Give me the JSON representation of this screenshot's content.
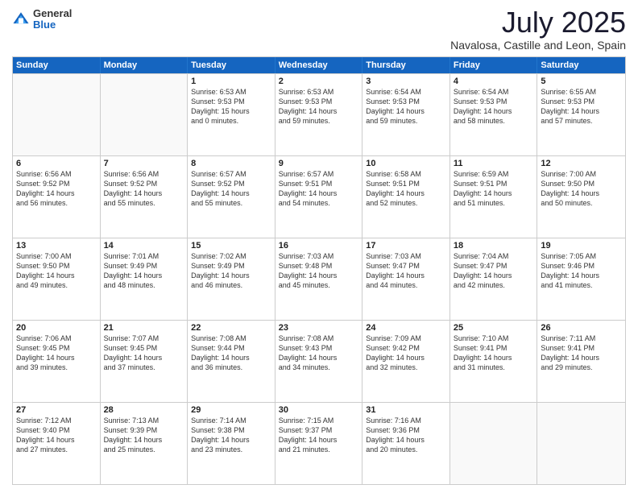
{
  "header": {
    "logo": {
      "general": "General",
      "blue": "Blue"
    },
    "title": "July 2025",
    "location": "Navalosa, Castille and Leon, Spain"
  },
  "calendar": {
    "days": [
      "Sunday",
      "Monday",
      "Tuesday",
      "Wednesday",
      "Thursday",
      "Friday",
      "Saturday"
    ],
    "rows": [
      [
        {
          "day": "",
          "lines": []
        },
        {
          "day": "",
          "lines": []
        },
        {
          "day": "1",
          "lines": [
            "Sunrise: 6:53 AM",
            "Sunset: 9:53 PM",
            "Daylight: 15 hours",
            "and 0 minutes."
          ]
        },
        {
          "day": "2",
          "lines": [
            "Sunrise: 6:53 AM",
            "Sunset: 9:53 PM",
            "Daylight: 14 hours",
            "and 59 minutes."
          ]
        },
        {
          "day": "3",
          "lines": [
            "Sunrise: 6:54 AM",
            "Sunset: 9:53 PM",
            "Daylight: 14 hours",
            "and 59 minutes."
          ]
        },
        {
          "day": "4",
          "lines": [
            "Sunrise: 6:54 AM",
            "Sunset: 9:53 PM",
            "Daylight: 14 hours",
            "and 58 minutes."
          ]
        },
        {
          "day": "5",
          "lines": [
            "Sunrise: 6:55 AM",
            "Sunset: 9:53 PM",
            "Daylight: 14 hours",
            "and 57 minutes."
          ]
        }
      ],
      [
        {
          "day": "6",
          "lines": [
            "Sunrise: 6:56 AM",
            "Sunset: 9:52 PM",
            "Daylight: 14 hours",
            "and 56 minutes."
          ]
        },
        {
          "day": "7",
          "lines": [
            "Sunrise: 6:56 AM",
            "Sunset: 9:52 PM",
            "Daylight: 14 hours",
            "and 55 minutes."
          ]
        },
        {
          "day": "8",
          "lines": [
            "Sunrise: 6:57 AM",
            "Sunset: 9:52 PM",
            "Daylight: 14 hours",
            "and 55 minutes."
          ]
        },
        {
          "day": "9",
          "lines": [
            "Sunrise: 6:57 AM",
            "Sunset: 9:51 PM",
            "Daylight: 14 hours",
            "and 54 minutes."
          ]
        },
        {
          "day": "10",
          "lines": [
            "Sunrise: 6:58 AM",
            "Sunset: 9:51 PM",
            "Daylight: 14 hours",
            "and 52 minutes."
          ]
        },
        {
          "day": "11",
          "lines": [
            "Sunrise: 6:59 AM",
            "Sunset: 9:51 PM",
            "Daylight: 14 hours",
            "and 51 minutes."
          ]
        },
        {
          "day": "12",
          "lines": [
            "Sunrise: 7:00 AM",
            "Sunset: 9:50 PM",
            "Daylight: 14 hours",
            "and 50 minutes."
          ]
        }
      ],
      [
        {
          "day": "13",
          "lines": [
            "Sunrise: 7:00 AM",
            "Sunset: 9:50 PM",
            "Daylight: 14 hours",
            "and 49 minutes."
          ]
        },
        {
          "day": "14",
          "lines": [
            "Sunrise: 7:01 AM",
            "Sunset: 9:49 PM",
            "Daylight: 14 hours",
            "and 48 minutes."
          ]
        },
        {
          "day": "15",
          "lines": [
            "Sunrise: 7:02 AM",
            "Sunset: 9:49 PM",
            "Daylight: 14 hours",
            "and 46 minutes."
          ]
        },
        {
          "day": "16",
          "lines": [
            "Sunrise: 7:03 AM",
            "Sunset: 9:48 PM",
            "Daylight: 14 hours",
            "and 45 minutes."
          ]
        },
        {
          "day": "17",
          "lines": [
            "Sunrise: 7:03 AM",
            "Sunset: 9:47 PM",
            "Daylight: 14 hours",
            "and 44 minutes."
          ]
        },
        {
          "day": "18",
          "lines": [
            "Sunrise: 7:04 AM",
            "Sunset: 9:47 PM",
            "Daylight: 14 hours",
            "and 42 minutes."
          ]
        },
        {
          "day": "19",
          "lines": [
            "Sunrise: 7:05 AM",
            "Sunset: 9:46 PM",
            "Daylight: 14 hours",
            "and 41 minutes."
          ]
        }
      ],
      [
        {
          "day": "20",
          "lines": [
            "Sunrise: 7:06 AM",
            "Sunset: 9:45 PM",
            "Daylight: 14 hours",
            "and 39 minutes."
          ]
        },
        {
          "day": "21",
          "lines": [
            "Sunrise: 7:07 AM",
            "Sunset: 9:45 PM",
            "Daylight: 14 hours",
            "and 37 minutes."
          ]
        },
        {
          "day": "22",
          "lines": [
            "Sunrise: 7:08 AM",
            "Sunset: 9:44 PM",
            "Daylight: 14 hours",
            "and 36 minutes."
          ]
        },
        {
          "day": "23",
          "lines": [
            "Sunrise: 7:08 AM",
            "Sunset: 9:43 PM",
            "Daylight: 14 hours",
            "and 34 minutes."
          ]
        },
        {
          "day": "24",
          "lines": [
            "Sunrise: 7:09 AM",
            "Sunset: 9:42 PM",
            "Daylight: 14 hours",
            "and 32 minutes."
          ]
        },
        {
          "day": "25",
          "lines": [
            "Sunrise: 7:10 AM",
            "Sunset: 9:41 PM",
            "Daylight: 14 hours",
            "and 31 minutes."
          ]
        },
        {
          "day": "26",
          "lines": [
            "Sunrise: 7:11 AM",
            "Sunset: 9:41 PM",
            "Daylight: 14 hours",
            "and 29 minutes."
          ]
        }
      ],
      [
        {
          "day": "27",
          "lines": [
            "Sunrise: 7:12 AM",
            "Sunset: 9:40 PM",
            "Daylight: 14 hours",
            "and 27 minutes."
          ]
        },
        {
          "day": "28",
          "lines": [
            "Sunrise: 7:13 AM",
            "Sunset: 9:39 PM",
            "Daylight: 14 hours",
            "and 25 minutes."
          ]
        },
        {
          "day": "29",
          "lines": [
            "Sunrise: 7:14 AM",
            "Sunset: 9:38 PM",
            "Daylight: 14 hours",
            "and 23 minutes."
          ]
        },
        {
          "day": "30",
          "lines": [
            "Sunrise: 7:15 AM",
            "Sunset: 9:37 PM",
            "Daylight: 14 hours",
            "and 21 minutes."
          ]
        },
        {
          "day": "31",
          "lines": [
            "Sunrise: 7:16 AM",
            "Sunset: 9:36 PM",
            "Daylight: 14 hours",
            "and 20 minutes."
          ]
        },
        {
          "day": "",
          "lines": []
        },
        {
          "day": "",
          "lines": []
        }
      ]
    ]
  }
}
